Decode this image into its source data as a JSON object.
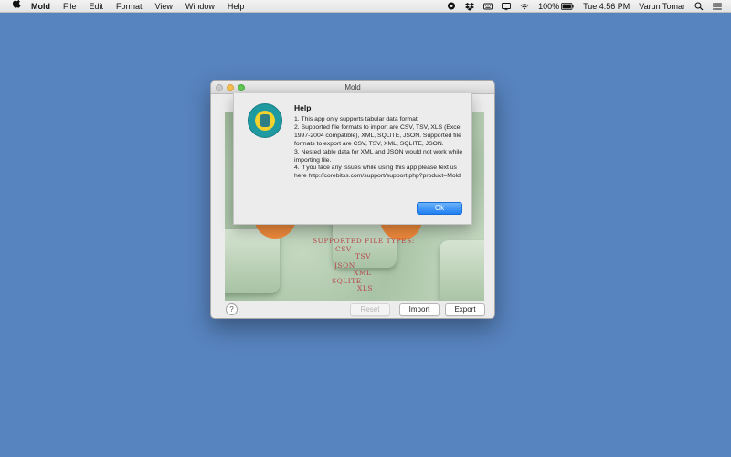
{
  "menubar": {
    "app_name": "Mold",
    "items": [
      "File",
      "Edit",
      "Format",
      "View",
      "Window",
      "Help"
    ],
    "battery": "100%",
    "clock": "Tue 4:56 PM",
    "user": "Varun Tomar"
  },
  "window": {
    "title": "Mold",
    "file_types": {
      "header": "SUPPORTED FILE TYPES:",
      "csv": "CSV",
      "tsv": "TSV",
      "json": "JSON",
      "xml": "XML",
      "sqlite": "SQLITE",
      "xls": "XLS"
    },
    "buttons": {
      "help": "?",
      "reset": "Reset",
      "import": "Import",
      "export": "Export"
    }
  },
  "help_sheet": {
    "title": "Help",
    "lines": [
      "1. This app only supports tabular data format.",
      "2. Supported file formats to import are CSV, TSV, XLS (Excel 1997-2004 compatible), XML, SQLITE, JSON. Supported file formats to export are CSV, TSV, XML, SQLITE, JSON.",
      "3. Nested table data for XML and JSON would not work while importing file.",
      "4. If you face any issues while using this app please text us here http://corebitss.com/support/support.php?product=Mold"
    ],
    "ok_label": "Ok"
  },
  "colors": {
    "desktop": "#5783BE",
    "accent": "#1f7ff3",
    "file_type_text": "#b7474a"
  }
}
